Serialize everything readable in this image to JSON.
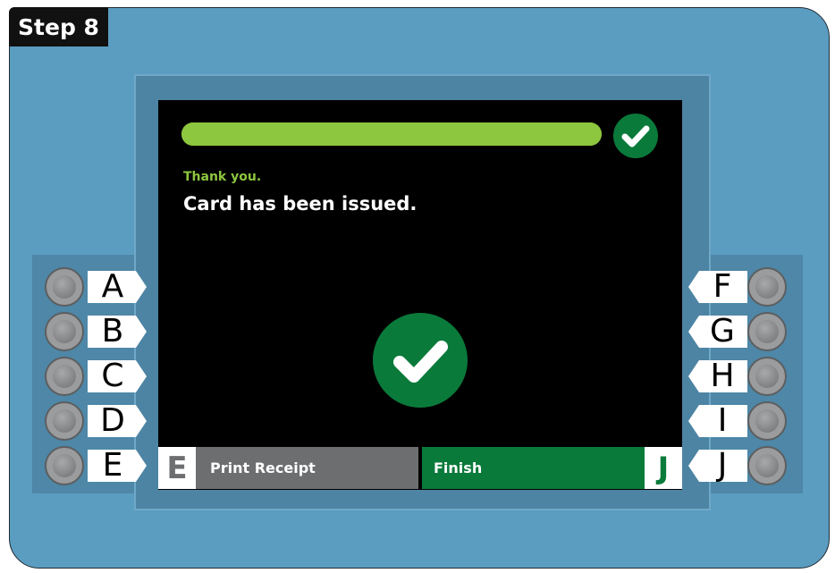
{
  "step_label": "Step 8",
  "screen": {
    "progress_fraction": 1.0,
    "thanks_text": "Thank you.",
    "message": "Card has been issued.",
    "top_icon": "check-icon",
    "center_icon": "check-icon",
    "left_button": {
      "letter": "E",
      "label": "Print Receipt"
    },
    "right_button": {
      "letter": "J",
      "label": "Finish"
    }
  },
  "left_keys": [
    "A",
    "B",
    "C",
    "D",
    "E"
  ],
  "right_keys": [
    "F",
    "G",
    "H",
    "I",
    "J"
  ],
  "colors": {
    "frame": "#5b9dc1",
    "accent_green": "#0a7a3b",
    "progress_green": "#8dc63f",
    "button_gray": "#6d6e70"
  }
}
